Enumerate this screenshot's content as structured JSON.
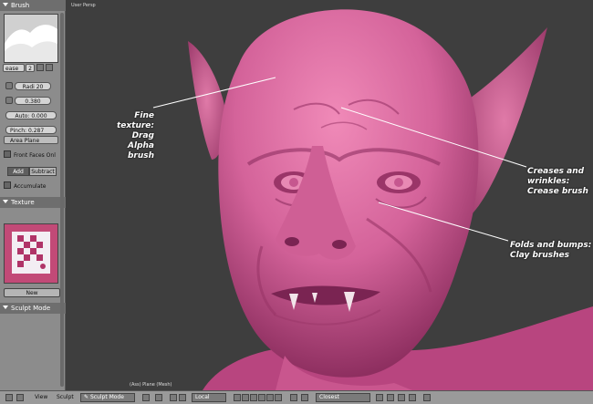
{
  "viewport": {
    "label": "User Persp",
    "status": "(Ass) Plane (Mesh)",
    "annotations": [
      {
        "lines": [
          "Fine texture:",
          "Drag Alpha brush"
        ]
      },
      {
        "lines": [
          "Creases and",
          "wrinkles:",
          "Crease brush"
        ]
      },
      {
        "lines": [
          "Folds and bumps:",
          "Clay brushes"
        ]
      }
    ]
  },
  "panel": {
    "brush_header": "Brush",
    "brush_name": "ease",
    "brush_users": "2",
    "radius": "Radi 20",
    "strength": "0.380",
    "autosmooth": "Auto: 0.000",
    "pinch": "Pinch: 0.287",
    "plane": "Area Plane",
    "front_faces": "Front Faces Onl",
    "add": "Add",
    "subtract": "Subtract",
    "accumulate": "Accumulate",
    "texture_header": "Texture",
    "new_button": "New",
    "sculpt_header": "Sculpt Mode"
  },
  "footer": {
    "view": "View",
    "sculpt": "Sculpt",
    "mode": "Sculpt Mode",
    "orientation": "Local",
    "snap": "Closest"
  },
  "colors": {
    "skin": "#d46a98",
    "background": "#3e3e3e",
    "panel": "#8c8c8c"
  }
}
